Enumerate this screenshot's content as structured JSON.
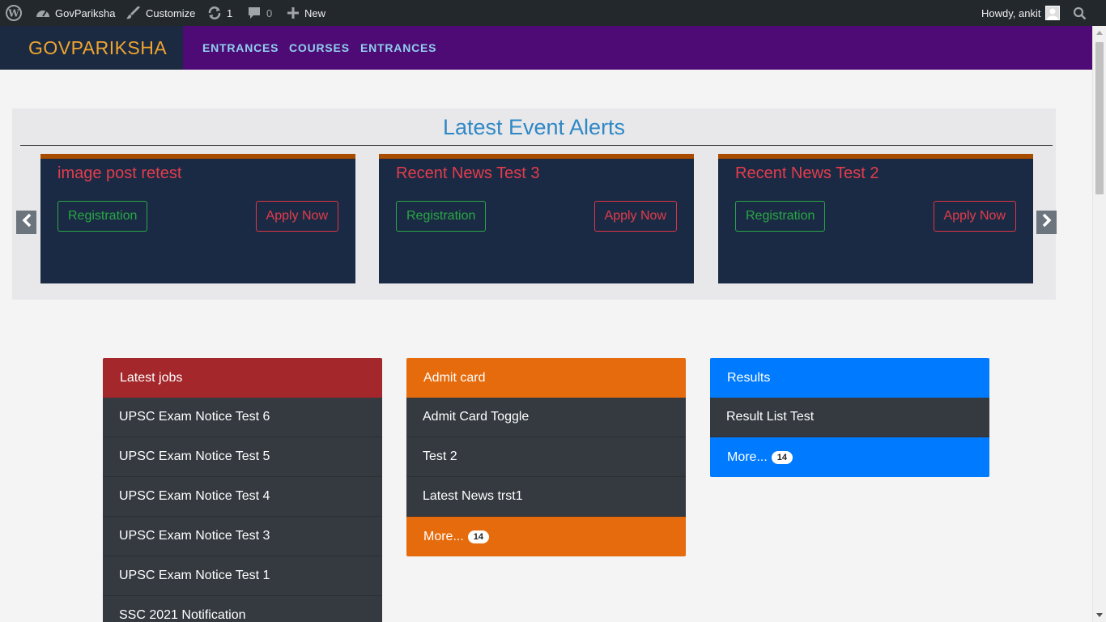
{
  "adminbar": {
    "site_name": "GovPariksha",
    "customize": "Customize",
    "updates_count": "1",
    "comments_count": "0",
    "new": "New",
    "howdy": "Howdy, ankit"
  },
  "header": {
    "brand": "GOVPARIKSHA",
    "nav": [
      "ENTRANCES",
      "COURSES",
      "ENTRANCES"
    ]
  },
  "alerts": {
    "title": "Latest Event Alerts",
    "cards": [
      {
        "title": "image post retest",
        "registration": "Registration",
        "apply": "Apply Now"
      },
      {
        "title": "Recent News Test 3",
        "registration": "Registration",
        "apply": "Apply Now"
      },
      {
        "title": "Recent News Test 2",
        "registration": "Registration",
        "apply": "Apply Now"
      }
    ]
  },
  "panels": {
    "jobs": {
      "title": "Latest jobs",
      "items": [
        "UPSC Exam Notice Test 6",
        "UPSC Exam Notice Test 5",
        "UPSC Exam Notice Test 4",
        "UPSC Exam Notice Test 3",
        "UPSC Exam Notice Test 1",
        "SSC 2021 Notification"
      ]
    },
    "admit": {
      "title": "Admit card",
      "items": [
        "Admit Card Toggle",
        "Test 2",
        "Latest News trst1"
      ],
      "more": "More...",
      "count": "14"
    },
    "results": {
      "title": "Results",
      "items": [
        "Result List Test"
      ],
      "more": "More...",
      "count": "14"
    }
  },
  "colors": {
    "adminbar": "#23282d",
    "header": "#4f0b75",
    "brand_bg": "#1b2a40",
    "brand_text": "#f0a530",
    "jobs_head": "#a3272b",
    "admit_head": "#e56b0c",
    "results_head": "#007bff"
  }
}
